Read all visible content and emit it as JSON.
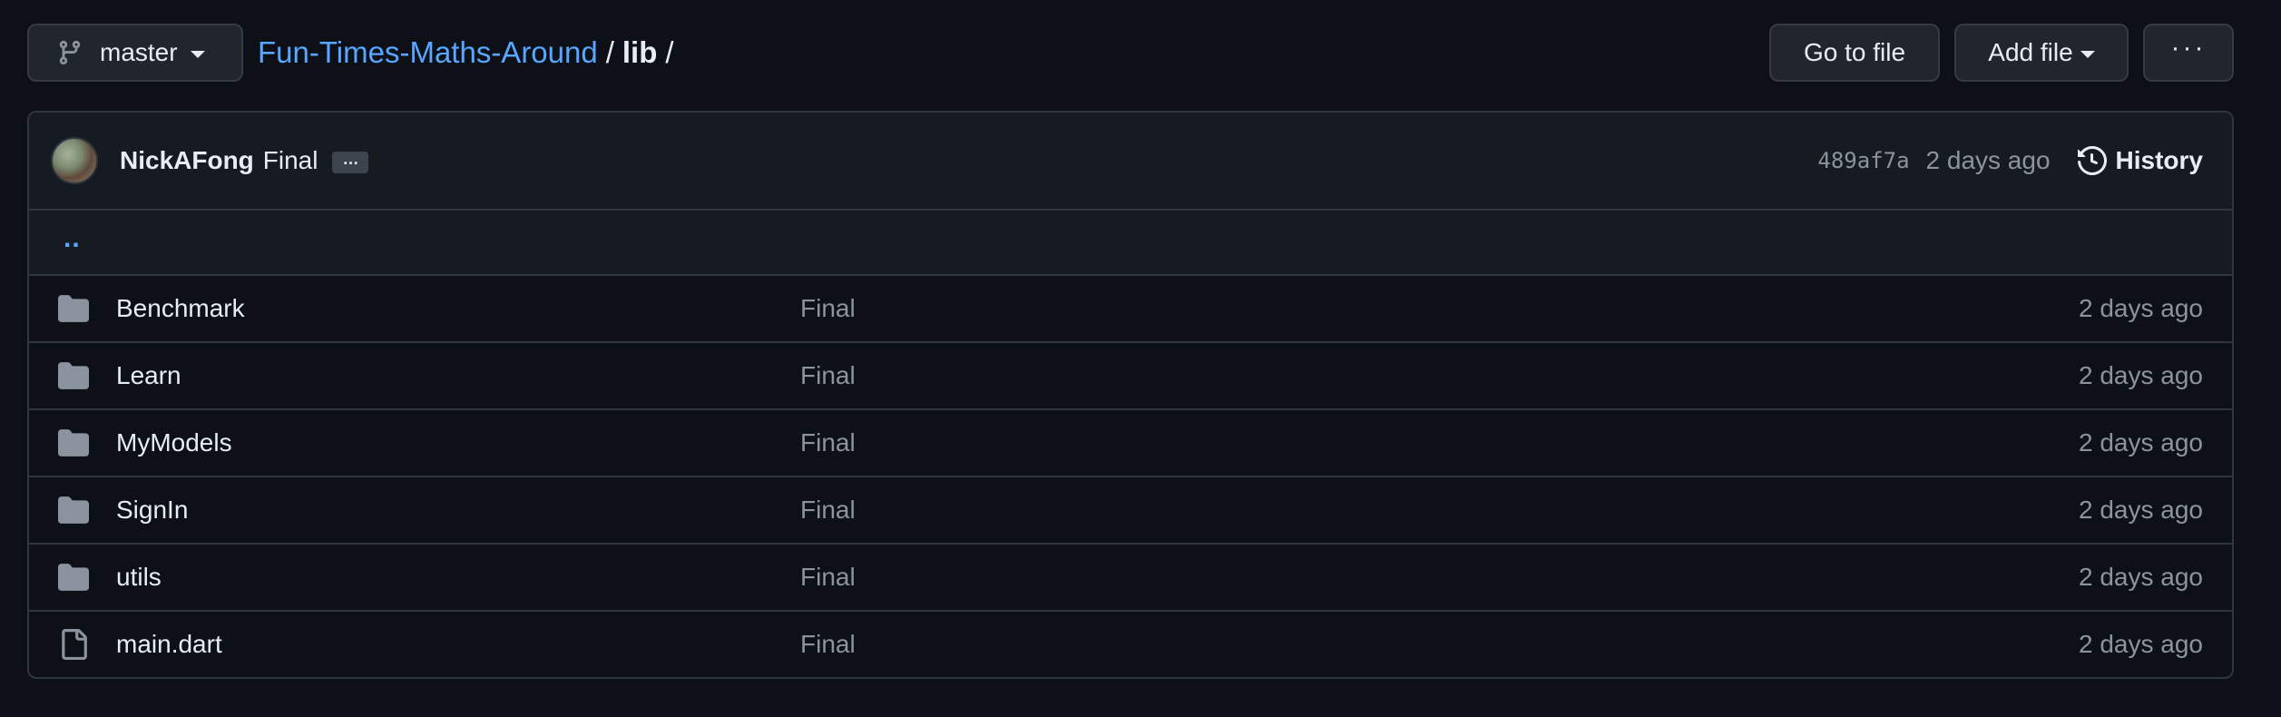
{
  "branch": {
    "name": "master",
    "icon": "git-branch-icon"
  },
  "breadcrumb": {
    "repo": "Fun-Times-Maths-Around",
    "sep1": "/",
    "current": "lib",
    "sep2": "/"
  },
  "actions": {
    "goto_label": "Go to file",
    "addfile_label": "Add file",
    "more_label": "···"
  },
  "commit": {
    "author": "NickAFong",
    "message": "Final",
    "ellipsis": "…",
    "sha": "489af7a",
    "age": "2 days ago",
    "history_label": "History"
  },
  "parent": {
    "label": ".."
  },
  "files": [
    {
      "type": "dir",
      "icon": "folder-icon",
      "name": "Benchmark",
      "message": "Final",
      "age": "2 days ago"
    },
    {
      "type": "dir",
      "icon": "folder-icon",
      "name": "Learn",
      "message": "Final",
      "age": "2 days ago"
    },
    {
      "type": "dir",
      "icon": "folder-icon",
      "name": "MyModels",
      "message": "Final",
      "age": "2 days ago"
    },
    {
      "type": "dir",
      "icon": "folder-icon",
      "name": "SignIn",
      "message": "Final",
      "age": "2 days ago"
    },
    {
      "type": "dir",
      "icon": "folder-icon",
      "name": "utils",
      "message": "Final",
      "age": "2 days ago"
    },
    {
      "type": "file",
      "icon": "file-icon",
      "name": "main.dart",
      "message": "Final",
      "age": "2 days ago"
    }
  ],
  "colors": {
    "background": "#0d1117",
    "link": "#58a6ff",
    "muted": "#8b949e",
    "border": "#30363d"
  }
}
